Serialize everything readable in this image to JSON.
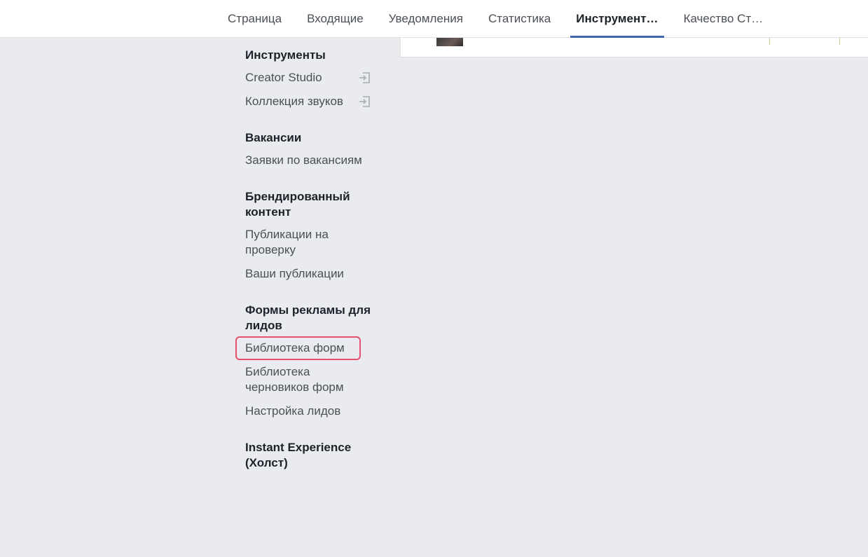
{
  "tabs": [
    {
      "label": "Страница"
    },
    {
      "label": "Входящие"
    },
    {
      "label": "Уведомления"
    },
    {
      "label": "Статистика"
    },
    {
      "label": "Инструмент…",
      "active": true
    },
    {
      "label": "Качество Ст…"
    }
  ],
  "sidebar": {
    "tools": {
      "title": "Инструменты",
      "items": [
        {
          "label": "Creator Studio",
          "icon": "external-link-icon"
        },
        {
          "label": "Коллекция звуков",
          "icon": "external-link-icon"
        }
      ]
    },
    "jobs": {
      "title": "Вакансии",
      "items": [
        {
          "label": "Заявки по вакансиям"
        }
      ]
    },
    "branded": {
      "title": "Брендированный контент",
      "items": [
        {
          "label": "Публикации на проверку"
        },
        {
          "label": "Ваши публикации"
        }
      ]
    },
    "lead_forms": {
      "title": "Формы рекламы для лидов",
      "items": [
        {
          "label": "Библиотека форм",
          "highlighted": true
        },
        {
          "label": "Библиотека черновиков форм"
        },
        {
          "label": "Настройка лидов"
        }
      ]
    },
    "instant": {
      "title": "Instant Experience (Холст)"
    }
  },
  "colors": {
    "accent": "#4267b2",
    "highlight_border": "#e6506e",
    "background": "#e9ebee"
  }
}
